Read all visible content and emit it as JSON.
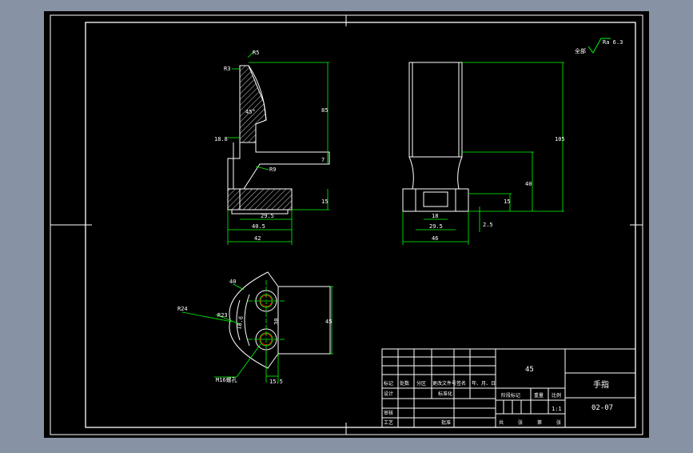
{
  "drawing": {
    "background": "#000000",
    "line_color": "#ffffff",
    "dimension_color": "#00ff00",
    "accent_color": "#ff0000",
    "roughness_label": "全部",
    "roughness_value": "Ra 6.3"
  },
  "front_view": {
    "dims": {
      "r5": "R5",
      "r3": "R3",
      "d_vert_long": "85",
      "d_angle": "45°",
      "d_188": "18.8",
      "d_7": "7",
      "r9": "R9",
      "d_15_left": "15",
      "d_295": "29.5",
      "d_405": "40.5",
      "d_42": "42"
    }
  },
  "side_view": {
    "dims": {
      "d_105": "105",
      "d_40": "40",
      "d_15": "15",
      "d_25": "2.5",
      "d_18": "18",
      "d_295": "29.5",
      "d_46": "46"
    }
  },
  "top_view": {
    "dims": {
      "d_40": "40",
      "r24": "R24",
      "r23": "R23",
      "d_116": "18.6",
      "d_30": "30",
      "d_45": "45",
      "thread": "M16螺孔",
      "d_155": "15.5"
    }
  },
  "title_block": {
    "material": "45",
    "part_name": "手指",
    "drawing_no": "02-07",
    "scale": "1:1",
    "header_cols": [
      "标记",
      "处数",
      "分区",
      "更改文件号",
      "签名",
      "年、月、日"
    ],
    "row_design": "设计",
    "row_standard": "标准化",
    "row_review": "审核",
    "row_process": "工艺",
    "row_approve": "批准",
    "stage_label": "阶段标记",
    "weight_label": "重量",
    "scale_label": "比例",
    "sheets_total": "共",
    "sheets_unit": "张",
    "sheet_no": "第",
    "sheet_unit2": "张"
  }
}
